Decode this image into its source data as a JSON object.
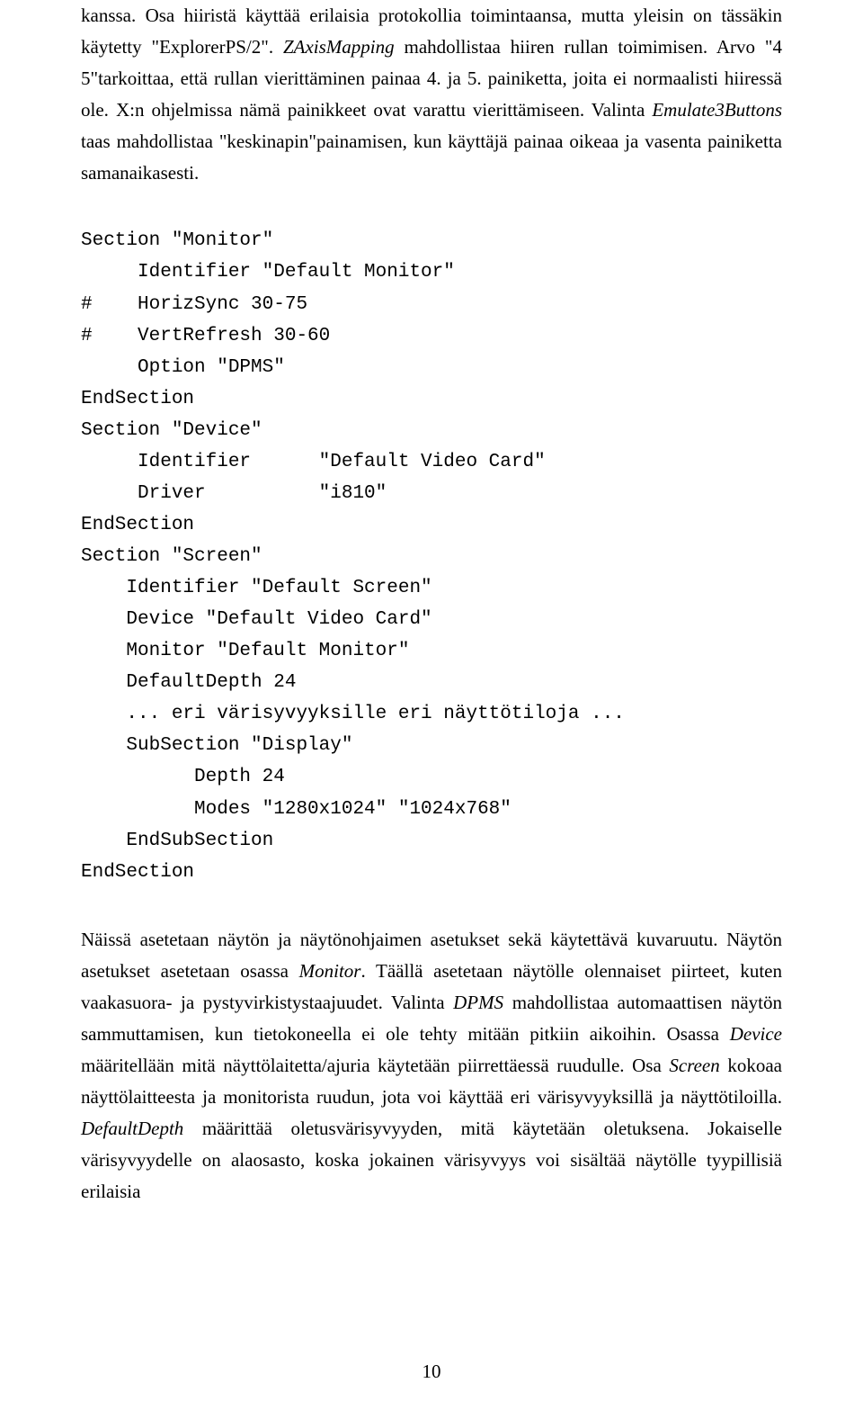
{
  "paragraph1": {
    "seg1": "kanssa. Osa hiiristä käyttää erilaisia protokollia toimintaansa, mutta yleisin on tässäkin käytetty \"ExplorerPS/2\". ",
    "italic1": "ZAxisMapping",
    "seg2": " mahdollistaa hiiren rullan toimimisen. Arvo \"4 5\"tarkoittaa, että rullan vierittäminen painaa 4. ja 5. painiketta, joita ei normaalisti hiiressä ole. X:n ohjelmissa nämä painikkeet ovat varattu vierittämiseen. Valinta ",
    "italic2": "Emulate3Buttons",
    "seg3": " taas mahdollistaa \"keskinapin\"painamisen, kun käyttäjä painaa oikeaa ja vasenta painiketta samanaikasesti."
  },
  "code": "Section \"Monitor\"\n     Identifier \"Default Monitor\"\n#    HorizSync 30-75\n#    VertRefresh 30-60\n     Option \"DPMS\"\nEndSection\nSection \"Device\"\n     Identifier      \"Default Video Card\"\n     Driver          \"i810\"\nEndSection\nSection \"Screen\"\n    Identifier \"Default Screen\"\n    Device \"Default Video Card\"\n    Monitor \"Default Monitor\"\n    DefaultDepth 24\n    ... eri värisyvyyksille eri näyttötiloja ...\n    SubSection \"Display\"\n          Depth 24\n          Modes \"1280x1024\" \"1024x768\"\n    EndSubSection\nEndSection",
  "paragraph2": {
    "seg1": "Näissä asetetaan näytön ja näytönohjaimen asetukset sekä käytettävä kuvaruutu. Näytön asetukset asetetaan osassa ",
    "italic1": "Monitor",
    "seg2": ". Täällä asetetaan näytölle olennaiset piirteet, kuten vaakasuora- ja pystyvirkistystaajuudet. Valinta ",
    "italic2": "DPMS",
    "seg3": " mahdollistaa automaattisen näytön sammuttamisen, kun tietokoneella ei ole tehty mitään pitkiin aikoihin. Osassa ",
    "italic3": "Device",
    "seg4": " määritellään mitä näyttölaitetta/ajuria käytetään piirrettäessä ruudulle. Osa ",
    "italic4": "Screen",
    "seg5": " kokoaa näyttölaitteesta ja monitorista ruudun, jota voi käyttää eri värisyvyyksillä ja näyttötiloilla. ",
    "italic5": "DefaultDepth",
    "seg6": " määrittää oletusvärisyvyyden, mitä käytetään oletuksena. Jokaiselle värisyvyydelle on alaosasto, koska jokainen värisyvyys voi sisältää näytölle tyypillisiä erilaisia"
  },
  "page_number": "10"
}
